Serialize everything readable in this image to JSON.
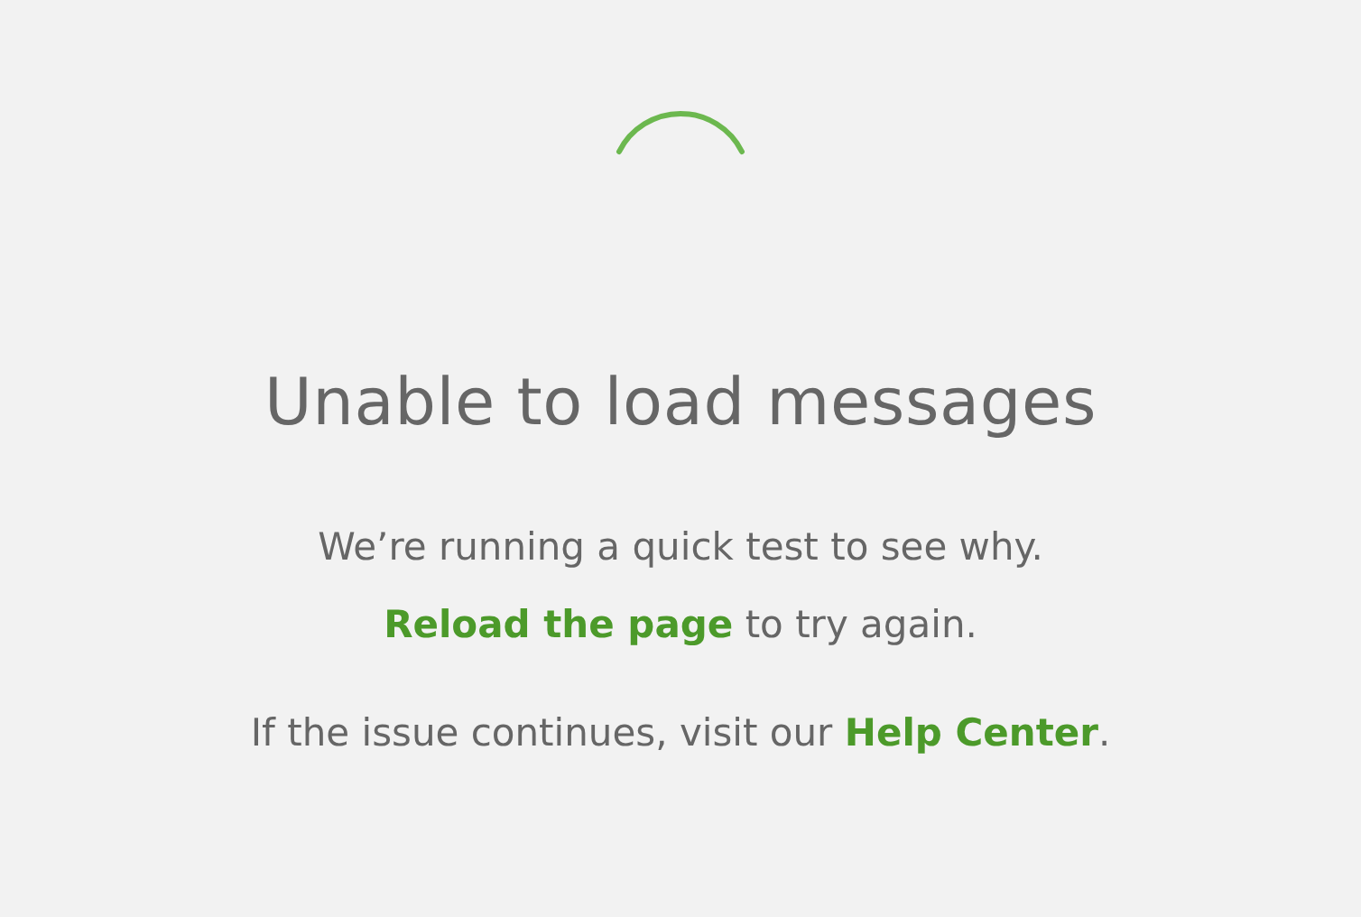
{
  "title": "Unable to load messages",
  "status_text": "We’re running a quick test to see why.",
  "reload_line": {
    "link": "Reload the page",
    "after": " to try again."
  },
  "help_line": {
    "before": "If the issue continues, visit our ",
    "link": "Help Center",
    "after": "."
  }
}
